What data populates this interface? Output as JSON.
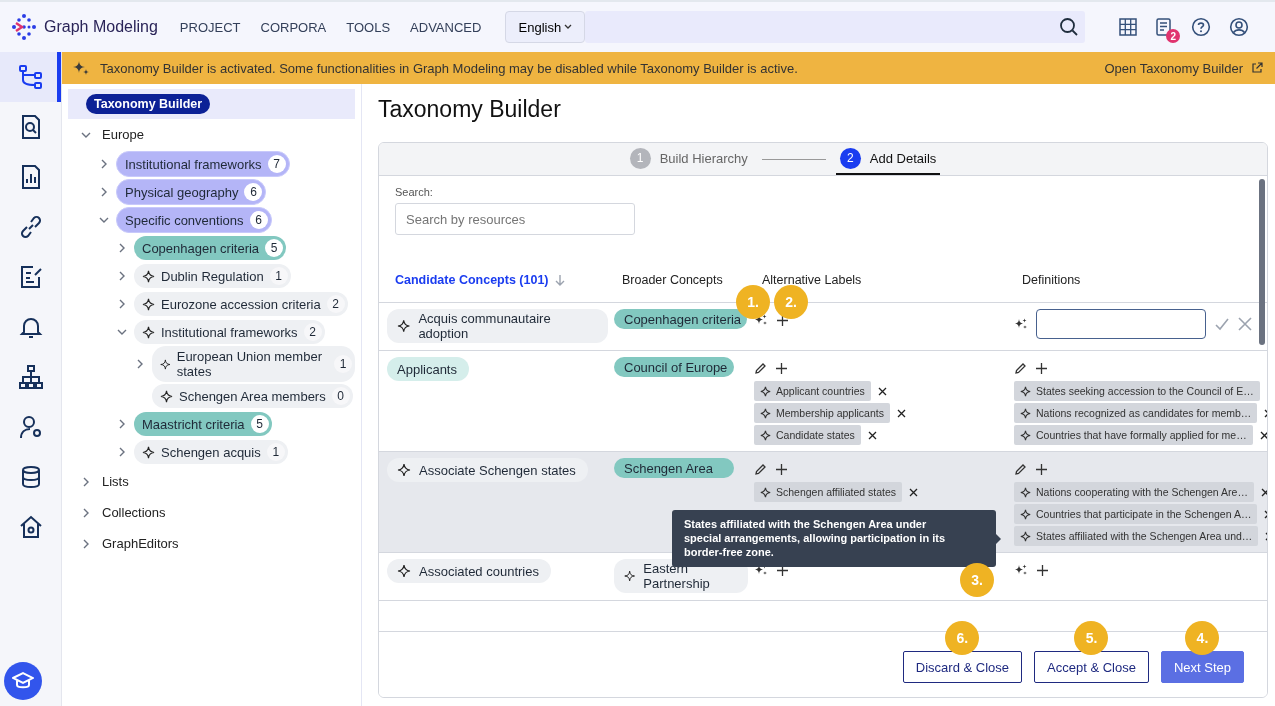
{
  "header": {
    "app_name": "Graph Modeling",
    "nav": [
      "PROJECT",
      "CORPORA",
      "TOOLS",
      "ADVANCED"
    ],
    "language": "English",
    "notification_count": "2"
  },
  "rail": [
    {
      "kind": "hierarchy",
      "selected": true
    },
    {
      "kind": "document-search",
      "selected": false
    },
    {
      "kind": "chart",
      "selected": false
    },
    {
      "kind": "link",
      "selected": false
    },
    {
      "kind": "checklist",
      "selected": false
    },
    {
      "kind": "bell",
      "selected": false
    },
    {
      "kind": "org-chart",
      "selected": false
    },
    {
      "kind": "user-gear",
      "selected": false
    },
    {
      "kind": "database",
      "selected": false
    },
    {
      "kind": "home-gear",
      "selected": false
    }
  ],
  "banner": {
    "message": "Taxonomy Builder is activated. Some functionalities in Graph Modeling may be disabled while Taxonomy Builder is active.",
    "link": "Open Taxonomy Builder"
  },
  "tree": {
    "root": {
      "label": "Taxonomy Builder",
      "selected": true
    },
    "items": [
      {
        "label": "Europe",
        "kind": "folder",
        "expanded": true,
        "children": [
          {
            "label": "Institutional frameworks",
            "kind": "group",
            "count": "7",
            "expanded": false
          },
          {
            "label": "Physical geography",
            "kind": "group",
            "count": "6",
            "expanded": false
          },
          {
            "label": "Specific conventions",
            "kind": "group",
            "count": "6",
            "expanded": true,
            "children": [
              {
                "label": "Copenhagen criteria",
                "kind": "concept",
                "count": "5",
                "expanded": false
              },
              {
                "label": "Dublin Regulation",
                "kind": "suggestion",
                "count": "1",
                "expanded": false
              },
              {
                "label": "Eurozone accession criteria",
                "kind": "suggestion",
                "count": "2",
                "expanded": false
              },
              {
                "label": "Institutional frameworks",
                "kind": "suggestion",
                "count": "2",
                "expanded": true,
                "children": [
                  {
                    "label": "European Union member states",
                    "kind": "suggestion",
                    "count": "1",
                    "expanded": false
                  },
                  {
                    "label": "Schengen Area members",
                    "kind": "suggestion",
                    "count": "0"
                  }
                ]
              },
              {
                "label": "Maastricht criteria",
                "kind": "concept",
                "count": "5",
                "expanded": false
              },
              {
                "label": "Schengen acquis",
                "kind": "suggestion",
                "count": "1",
                "expanded": false
              }
            ]
          }
        ]
      },
      {
        "label": "Lists",
        "kind": "folder",
        "expanded": false
      },
      {
        "label": "Collections",
        "kind": "folder",
        "expanded": false
      },
      {
        "label": "GraphEditors",
        "kind": "folder",
        "expanded": false
      }
    ]
  },
  "page_title": "Taxonomy Builder",
  "steps": [
    {
      "number": "1",
      "label": "Build Hierarchy",
      "selected": false
    },
    {
      "number": "2",
      "label": "Add Details",
      "selected": true
    }
  ],
  "search": {
    "label": "Search:",
    "placeholder": "Search by resources"
  },
  "table": {
    "columns": [
      {
        "label": "Candidate Concepts (101)",
        "sorted": true
      },
      {
        "label": "Broader Concepts",
        "sorted": false
      },
      {
        "label": "Alternative Labels",
        "sorted": false
      },
      {
        "label": "Definitions",
        "sorted": false
      }
    ],
    "rows": [
      {
        "selected": false,
        "concept": {
          "label": "Acquis communautaire adoption",
          "kind": "suggestion"
        },
        "broader": {
          "label": "Copenhagen criteria",
          "kind": "concept"
        },
        "alt_labels": {
          "actions": [
            {
              "kind": "generate",
              "callout": "1."
            },
            {
              "kind": "add",
              "callout": "2."
            }
          ]
        },
        "definitions": {
          "editing": true,
          "actions": [
            {
              "kind": "generate"
            }
          ]
        }
      },
      {
        "selected": false,
        "concept": {
          "label": "Applicants",
          "kind": "accepted"
        },
        "broader": {
          "label": "Council of Europe",
          "kind": "concept"
        },
        "alt_labels": {
          "actions": [
            {
              "kind": "edit"
            },
            {
              "kind": "add"
            }
          ],
          "items": [
            "Applicant countries",
            "Membership applicants",
            "Candidate states"
          ]
        },
        "definitions": {
          "editing": false,
          "actions": [
            {
              "kind": "edit"
            },
            {
              "kind": "add"
            }
          ],
          "items": [
            "States seeking accession to the Council of E…",
            "Nations recognized as candidates for memb…",
            "Countries that have formally applied for me…"
          ]
        }
      },
      {
        "selected": true,
        "concept": {
          "label": "Associate Schengen states",
          "kind": "suggestion"
        },
        "broader": {
          "label": "Schengen Area",
          "kind": "concept"
        },
        "alt_labels": {
          "actions": [
            {
              "kind": "edit"
            },
            {
              "kind": "add"
            }
          ],
          "items": [
            "Schengen affiliated states"
          ]
        },
        "definitions": {
          "editing": false,
          "actions": [
            {
              "kind": "edit"
            },
            {
              "kind": "add"
            }
          ],
          "items": [
            "Nations cooperating with the Schengen Are…",
            "Countries that participate in the Schengen A…",
            "States affiliated with the Schengen Area und…"
          ]
        },
        "tooltip": {
          "text": "States affiliated with the Schengen Area under special arrangements, allowing participation in its border-free zone.",
          "callout": "3."
        }
      },
      {
        "selected": false,
        "concept": {
          "label": "Associated countries",
          "kind": "suggestion"
        },
        "broader": {
          "label": "Eastern Partnership",
          "kind": "suggestion"
        },
        "alt_labels": {
          "actions": [
            {
              "kind": "generate"
            },
            {
              "kind": "add"
            }
          ]
        },
        "definitions": {
          "editing": false,
          "actions": [
            {
              "kind": "generate"
            },
            {
              "kind": "add"
            }
          ]
        }
      }
    ]
  },
  "buttons": [
    {
      "label": "Discard & Close",
      "kind": "outline",
      "callout": "6."
    },
    {
      "label": "Accept & Close",
      "kind": "outline",
      "callout": "5."
    },
    {
      "label": "Next Step",
      "kind": "primary",
      "callout": "4."
    }
  ]
}
